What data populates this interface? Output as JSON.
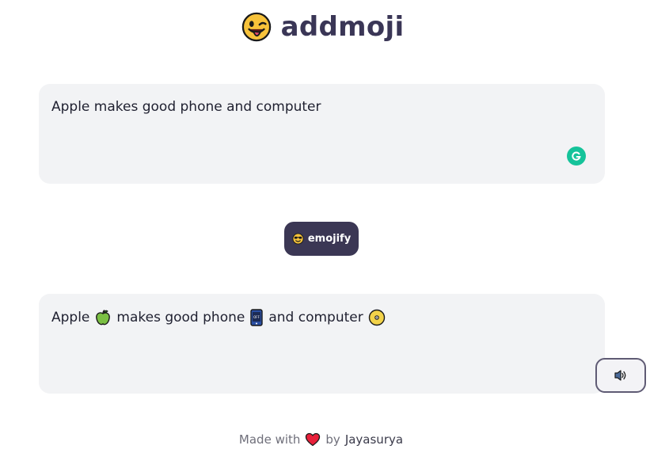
{
  "header": {
    "title": "addmoji",
    "logo_icon": "winking-face-with-tongue-icon"
  },
  "input": {
    "value": "Apple makes good phone and computer",
    "grammarly_icon": "grammarly-icon"
  },
  "emojify_button": {
    "label": "emojify",
    "icon": "smiling-face-with-sunglasses-icon"
  },
  "output": {
    "segments": [
      {
        "text": "Apple",
        "emoji": "green-apple-icon"
      },
      {
        "text": "makes good phone",
        "emoji": "mobile-phone-off-icon"
      },
      {
        "text": "and computer",
        "emoji": "cd-disc-icon"
      }
    ]
  },
  "speak_button": {
    "icon": "speaker-high-volume-icon"
  },
  "footer": {
    "prefix": "Made with",
    "heart_icon": "red-heart-icon",
    "by": "by",
    "author": "Jayasurya"
  },
  "colors": {
    "title": "#3a3656",
    "button_bg": "#3b3754",
    "box_bg": "#f2f3f5",
    "grammarly": "#15c39a"
  }
}
